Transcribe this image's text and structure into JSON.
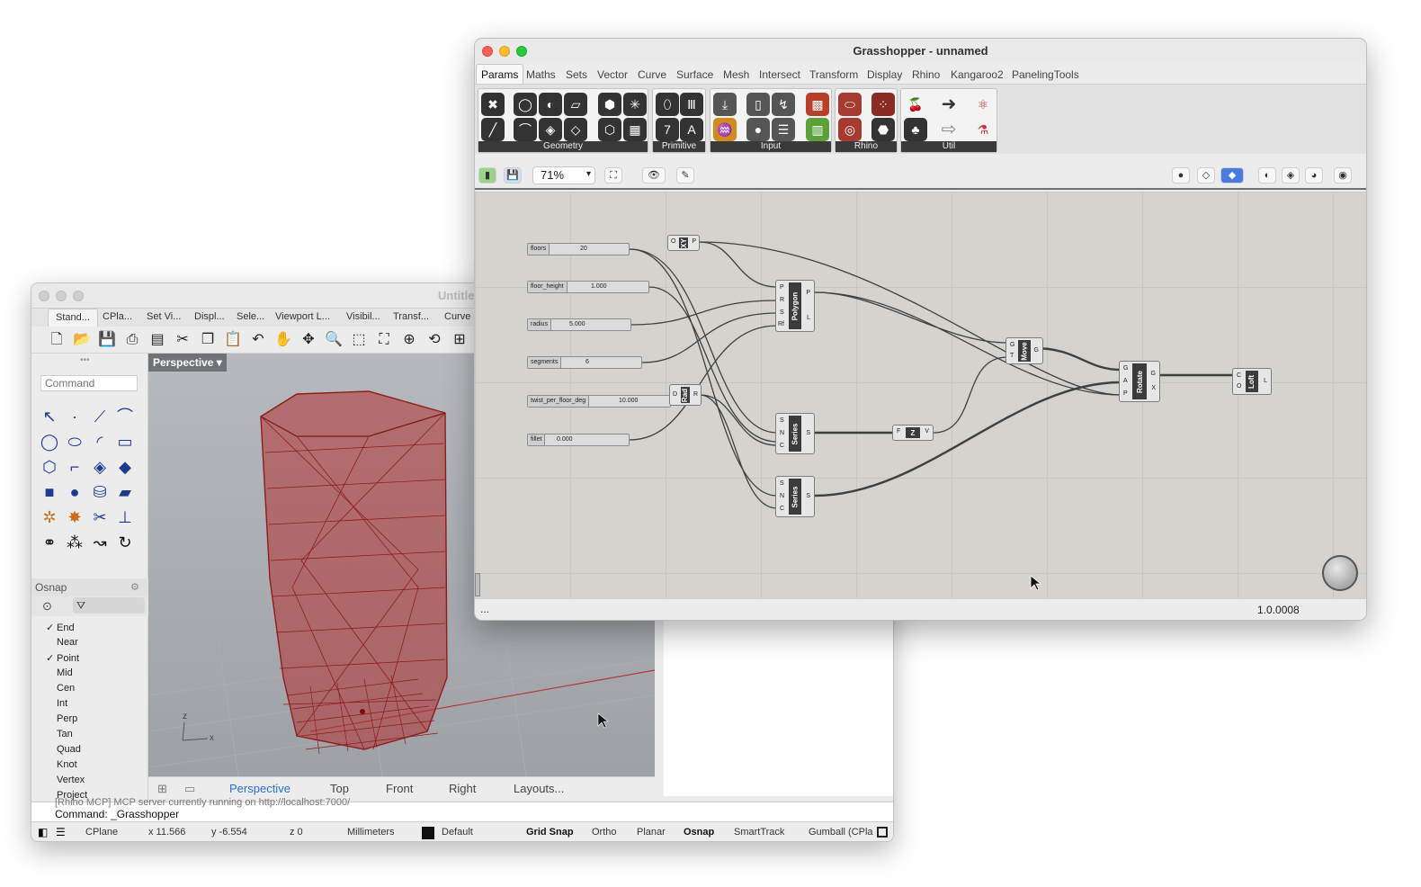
{
  "rhino": {
    "title": "Untitle",
    "tabs": [
      "Stand...",
      "CPla...",
      "Set Vi...",
      "Displ...",
      "Sele...",
      "Viewport L...",
      "Visibil...",
      "Transf...",
      "Curve"
    ],
    "command_placeholder": "Command",
    "osnap": {
      "header": "Osnap",
      "items": [
        {
          "label": "End",
          "checked": "✓"
        },
        {
          "label": "Near",
          "checked": ""
        },
        {
          "label": "Point",
          "checked": "✓"
        },
        {
          "label": "Mid",
          "checked": ""
        },
        {
          "label": "Cen",
          "checked": ""
        },
        {
          "label": "Int",
          "checked": ""
        },
        {
          "label": "Perp",
          "checked": ""
        },
        {
          "label": "Tan",
          "checked": ""
        },
        {
          "label": "Quad",
          "checked": ""
        },
        {
          "label": "Knot",
          "checked": ""
        },
        {
          "label": "Vertex",
          "checked": ""
        },
        {
          "label": "Project",
          "checked": ""
        }
      ]
    },
    "viewport_label": "Perspective",
    "viewport_tabs": [
      "Perspective",
      "Top",
      "Front",
      "Right",
      "Layouts..."
    ],
    "command_history": "[Rhino MCP] MCP server currently running on http://localhost:7000/",
    "command_line": "Command: _Grasshopper",
    "status": {
      "cplane": "CPlane",
      "x": "x 11.566",
      "y": "y -6.554",
      "z": "z 0",
      "units": "Millimeters",
      "layer": "Default",
      "grid_snap": "Grid Snap",
      "ortho": "Ortho",
      "planar": "Planar",
      "osnap": "Osnap",
      "smarttrack": "SmartTrack",
      "gumball": "Gumball (CPla"
    },
    "axis": {
      "z": "z",
      "x": "x"
    }
  },
  "grasshopper": {
    "title": "Grasshopper - unnamed",
    "tabs": [
      "Params",
      "Maths",
      "Sets",
      "Vector",
      "Curve",
      "Surface",
      "Mesh",
      "Intersect",
      "Transform",
      "Display",
      "Rhino",
      "Kangaroo2",
      "PanelingTools"
    ],
    "ribbon_groups": [
      "Geometry",
      "Primitive",
      "Input",
      "Rhino",
      "Util"
    ],
    "zoom": "71%",
    "sliders": [
      {
        "name": "floors",
        "value": "20"
      },
      {
        "name": "floor_height",
        "value": "1.000"
      },
      {
        "name": "radius",
        "value": "5.000"
      },
      {
        "name": "segments",
        "value": "6"
      },
      {
        "name": "twist_per_floor_deg",
        "value": "10.000"
      },
      {
        "name": "fillet",
        "value": "0.000"
      }
    ],
    "components": {
      "xy": {
        "label": "XY",
        "in": [
          "O"
        ],
        "out": [
          "P"
        ]
      },
      "polygon": {
        "label": "Polygon",
        "in": [
          "P",
          "R",
          "S",
          "Rf"
        ],
        "out": [
          "P",
          "L"
        ]
      },
      "rad": {
        "label": "Rad",
        "in": [
          "D"
        ],
        "out": [
          "R"
        ]
      },
      "series1": {
        "label": "Series",
        "in": [
          "S",
          "N",
          "C"
        ],
        "out": [
          "S"
        ]
      },
      "series2": {
        "label": "Series",
        "in": [
          "S",
          "N",
          "C"
        ],
        "out": [
          "S"
        ]
      },
      "unitz": {
        "label": "Z",
        "in": [
          "F"
        ],
        "out": [
          "V"
        ]
      },
      "move": {
        "label": "Move",
        "in": [
          "G",
          "T"
        ],
        "out": [
          "G"
        ]
      },
      "rotate": {
        "label": "Rotate",
        "in": [
          "G",
          "A",
          "P"
        ],
        "out": [
          "G",
          "X"
        ]
      },
      "loft": {
        "label": "Loft",
        "in": [
          "C",
          "O"
        ],
        "out": [
          "L"
        ]
      }
    },
    "status_left": "...",
    "version": "1.0.0008"
  }
}
